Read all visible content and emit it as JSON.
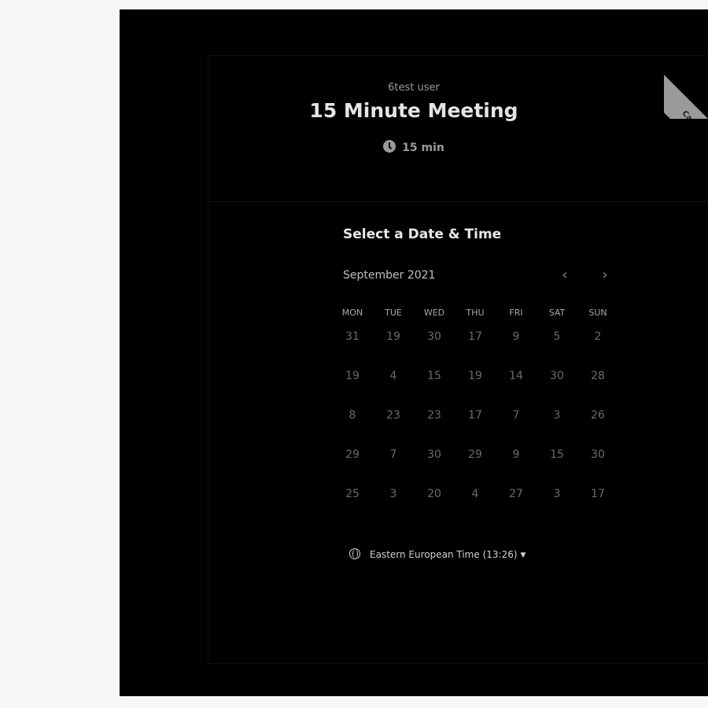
{
  "host_name": "6test user",
  "event_title": "15 Minute Meeting",
  "duration": "15 min",
  "ribbon_text": "Ca",
  "section_title": "Select a Date & Time",
  "month_label": "September 2021",
  "nav": {
    "prev": "‹",
    "next": "›"
  },
  "weekdays": [
    "MON",
    "TUE",
    "WED",
    "THU",
    "FRI",
    "SAT",
    "SUN"
  ],
  "weeks": [
    [
      "31",
      "19",
      "30",
      "17",
      "9",
      "5",
      "2"
    ],
    [
      "19",
      "4",
      "15",
      "19",
      "14",
      "30",
      "28"
    ],
    [
      "8",
      "23",
      "23",
      "17",
      "7",
      "3",
      "26"
    ],
    [
      "29",
      "7",
      "30",
      "29",
      "9",
      "15",
      "30"
    ],
    [
      "25",
      "3",
      "20",
      "4",
      "27",
      "3",
      "17"
    ]
  ],
  "timezone": "Eastern European Time (13:26)",
  "icons": {
    "duration": "clock-icon",
    "timezone": "globe-icon",
    "dropdown": "caret-down-icon"
  },
  "colors": {
    "background": "#000000",
    "text_primary": "#e4e4e4",
    "text_muted": "#9a9a9a"
  }
}
